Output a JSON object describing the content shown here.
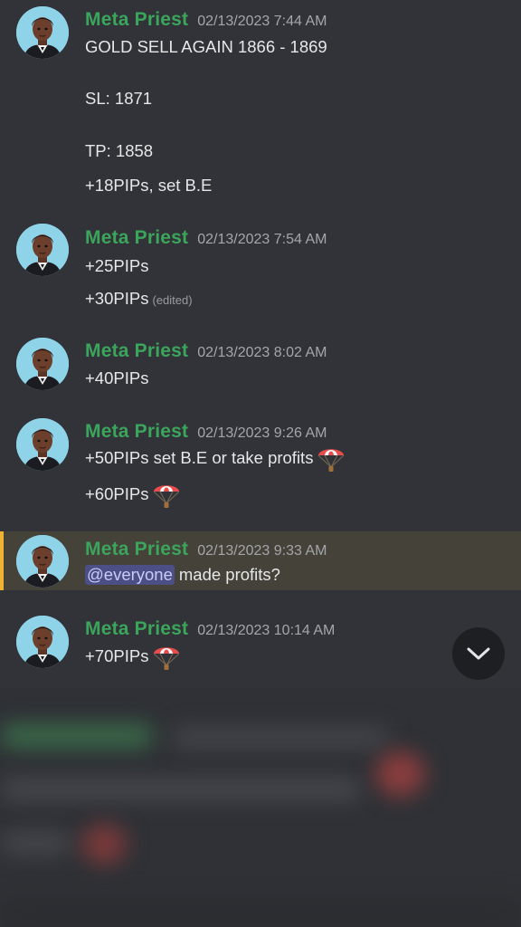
{
  "colors": {
    "background": "#313338",
    "author": "#3ba55c",
    "timestamp": "#a3a6aa",
    "text": "#e6e7e9",
    "mention_bg": "#4b4f85",
    "highlight_bg": "#45423a",
    "highlight_bar": "#f0b232"
  },
  "messages": [
    {
      "author": "Meta Priest",
      "timestamp": "02/13/2023 7:44 AM",
      "lines": [
        "GOLD SELL AGAIN 1866 - 1869",
        "SL: 1871",
        "TP: 1858",
        "+18PIPs, set B.E"
      ]
    },
    {
      "author": "Meta Priest",
      "timestamp": "02/13/2023 7:54 AM",
      "lines": [
        "+25PIPs",
        "+30PIPs"
      ],
      "edited_label": "(edited)"
    },
    {
      "author": "Meta Priest",
      "timestamp": "02/13/2023 8:02 AM",
      "lines": [
        "+40PIPs"
      ]
    },
    {
      "author": "Meta Priest",
      "timestamp": "02/13/2023 9:26 AM",
      "lines": [
        "+50PIPs set B.E or take profits",
        "+60PIPs"
      ],
      "emoji": "parachute-emoji"
    },
    {
      "author": "Meta Priest",
      "timestamp": "02/13/2023 9:33 AM",
      "mention": "@everyone",
      "lines": [
        "made profits?"
      ]
    },
    {
      "author": "Meta Priest",
      "timestamp": "02/13/2023 10:14 AM",
      "lines": [
        "+70PIPs"
      ],
      "emoji": "parachute-emoji"
    }
  ],
  "scroll_button_icon": "chevron-down-icon"
}
